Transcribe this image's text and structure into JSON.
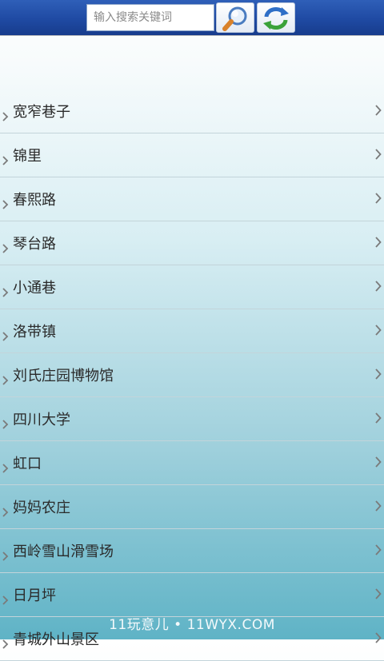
{
  "search": {
    "placeholder": "输入搜索关键词",
    "value": "",
    "search_icon": "magnifier-icon",
    "refresh_icon": "refresh-icon"
  },
  "places": [
    "宽窄巷子",
    "锦里",
    "春熙路",
    "琴台路",
    "小通巷",
    "洛带镇",
    "刘氏庄园博物馆",
    "四川大学",
    "虹口",
    "妈妈农庄",
    "西岭雪山滑雪场",
    "日月坪",
    "青城外山景区"
  ],
  "watermark": "11玩意儿 • 11WYX.COM",
  "colors": {
    "topbar": "#1f4aa3",
    "text": "#2a2a2a",
    "chevron": "#7a7a7a"
  }
}
